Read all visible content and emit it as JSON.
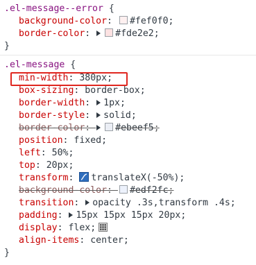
{
  "rule_error": {
    "selector": ".el-message--error",
    "open_brace": "{",
    "close_brace": "}",
    "decls": [
      {
        "prop": "background-color",
        "value": "#fef0f0",
        "swatch": "#fef0f0"
      },
      {
        "prop": "border-color",
        "value": "#fde2e2",
        "swatch": "#fde2e2"
      }
    ]
  },
  "rule_message": {
    "selector": ".el-message",
    "open_brace": "{",
    "close_brace": "}",
    "decls": [
      {
        "prop": "min-width",
        "value": "380px"
      },
      {
        "prop": "box-sizing",
        "value": "border-box"
      },
      {
        "prop": "border-width",
        "value": "1px"
      },
      {
        "prop": "border-style",
        "value": "solid"
      },
      {
        "prop": "border-color",
        "value": "#ebeef5",
        "swatch": "#ebeef5"
      },
      {
        "prop": "position",
        "value": "fixed"
      },
      {
        "prop": "left",
        "value": "50%"
      },
      {
        "prop": "top",
        "value": "20px"
      },
      {
        "prop": "transform",
        "value": "translateX(-50%)"
      },
      {
        "prop": "background-color",
        "value": "#edf2fc",
        "swatch": "#edf2fc"
      },
      {
        "prop": "transition",
        "value": "opacity .3s,transform .4s"
      },
      {
        "prop": "padding",
        "value": "15px 15px 15px 20px"
      },
      {
        "prop": "display",
        "value": "flex"
      },
      {
        "prop": "align-items",
        "value": "center"
      }
    ]
  },
  "colors": {
    "selector": "#881280",
    "property": "#c80000",
    "highlight": "#e0261f"
  },
  "icons": {
    "expand": "expand-triangle-icon",
    "curve": "cubic-bezier-editor-icon",
    "flex": "flexbox-editor-icon"
  }
}
